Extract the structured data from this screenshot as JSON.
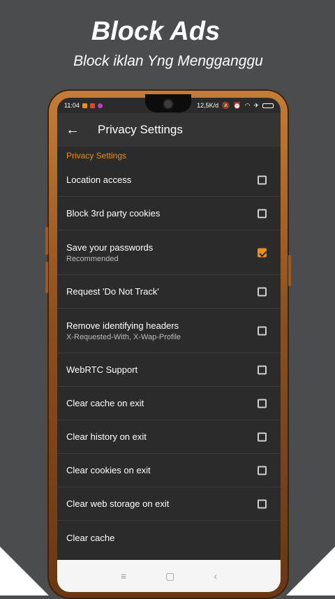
{
  "promo": {
    "title": "Block Ads",
    "subtitle": "Block iklan Yng Mengganggu"
  },
  "status_bar": {
    "time": "11:04",
    "speed": "12,5K/d"
  },
  "toolbar": {
    "back_icon": "arrow-left-icon",
    "title": "Privacy Settings"
  },
  "section_header": "Privacy Settings",
  "settings": [
    {
      "label": "Location access",
      "sub": "",
      "checked": false
    },
    {
      "label": "Block 3rd party cookies",
      "sub": "",
      "checked": false
    },
    {
      "label": "Save your passwords",
      "sub": "Recommended",
      "checked": true
    },
    {
      "label": "Request 'Do Not Track'",
      "sub": "",
      "checked": false
    },
    {
      "label": "Remove identifying headers",
      "sub": "X-Requested-With, X-Wap-Profile",
      "checked": false
    },
    {
      "label": "WebRTC Support",
      "sub": "",
      "checked": false
    },
    {
      "label": "Clear cache on exit",
      "sub": "",
      "checked": false
    },
    {
      "label": "Clear history on exit",
      "sub": "",
      "checked": false
    },
    {
      "label": "Clear cookies on exit",
      "sub": "",
      "checked": false
    },
    {
      "label": "Clear web storage on exit",
      "sub": "",
      "checked": false
    },
    {
      "label": "Clear cache",
      "sub": "",
      "checked": null
    }
  ],
  "nav": {
    "menu_icon": "menu-icon",
    "home_icon": "home-square-icon",
    "back_icon": "back-chevron-icon"
  },
  "colors": {
    "accent": "#f08c1a",
    "background": "#4a4c4e",
    "screen": "#2b2b2b"
  }
}
